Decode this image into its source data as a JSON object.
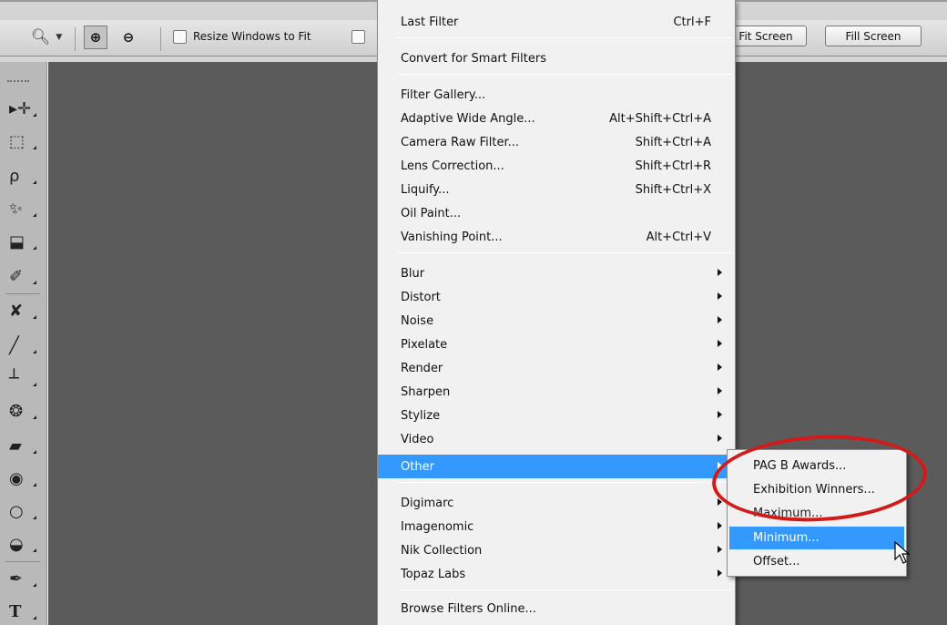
{
  "options_bar": {
    "resize_windows_label": "Resize Windows to Fit",
    "fit_screen_label": "Fit Screen",
    "fill_screen_label": "Fill Screen"
  },
  "filter_menu": {
    "top_items": [
      {
        "label": "Last Filter",
        "shortcut": "Ctrl+F"
      },
      {
        "label": "Convert for Smart Filters",
        "shortcut": ""
      }
    ],
    "gallery_items": [
      {
        "label": "Filter Gallery...",
        "shortcut": ""
      },
      {
        "label": "Adaptive Wide Angle...",
        "shortcut": "Alt+Shift+Ctrl+A"
      },
      {
        "label": "Camera Raw Filter...",
        "shortcut": "Shift+Ctrl+A"
      },
      {
        "label": "Lens Correction...",
        "shortcut": "Shift+Ctrl+R"
      },
      {
        "label": "Liquify...",
        "shortcut": "Shift+Ctrl+X"
      },
      {
        "label": "Oil Paint...",
        "shortcut": ""
      },
      {
        "label": "Vanishing Point...",
        "shortcut": "Alt+Ctrl+V"
      }
    ],
    "submenu_items": [
      "Blur",
      "Distort",
      "Noise",
      "Pixelate",
      "Render",
      "Sharpen",
      "Stylize",
      "Video",
      "Other"
    ],
    "selected_item": "Other",
    "plugin_items": [
      "Digimarc",
      "Imagenomic",
      "Nik Collection",
      "Topaz Labs"
    ],
    "browse_label": "Browse Filters Online..."
  },
  "other_submenu": {
    "items": [
      "PAG B Awards...",
      "Exhibition Winners...",
      "Maximum...",
      "Minimum...",
      "Offset..."
    ],
    "highlighted": "Minimum..."
  },
  "colors": {
    "highlight": "#3399ff",
    "annotation_ring": "#d21a1a",
    "canvas_bg": "#5b5b5b"
  }
}
